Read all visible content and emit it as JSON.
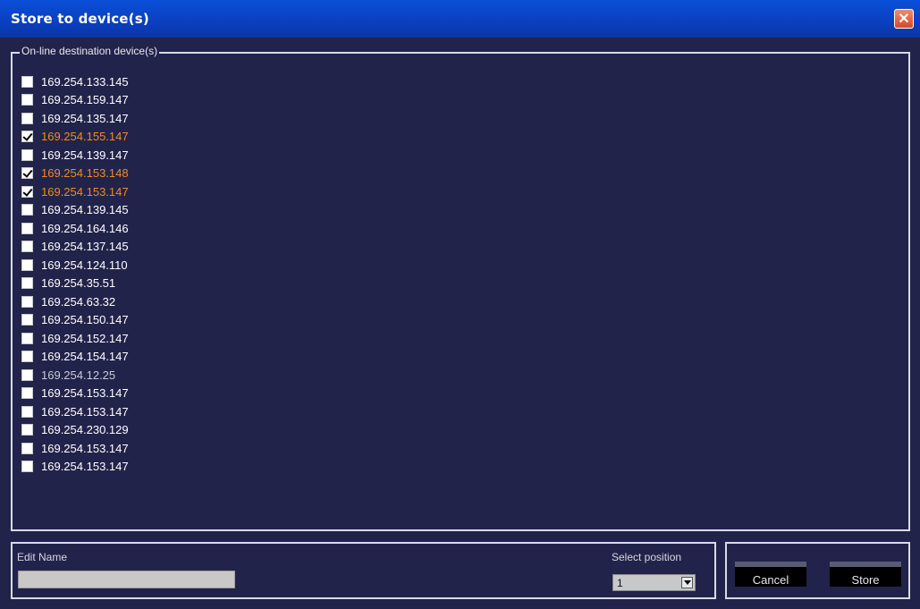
{
  "window": {
    "title": "Store to device(s)"
  },
  "devices_group": {
    "legend": "On-line destination device(s)",
    "items": [
      {
        "ip": "169.254.133.145",
        "checked": false,
        "state": "normal"
      },
      {
        "ip": "169.254.159.147",
        "checked": false,
        "state": "normal"
      },
      {
        "ip": "169.254.135.147",
        "checked": false,
        "state": "normal"
      },
      {
        "ip": "169.254.155.147",
        "checked": true,
        "state": "selected"
      },
      {
        "ip": "169.254.139.147",
        "checked": false,
        "state": "normal"
      },
      {
        "ip": "169.254.153.148",
        "checked": true,
        "state": "selected"
      },
      {
        "ip": "169.254.153.147",
        "checked": true,
        "state": "selected"
      },
      {
        "ip": "169.254.139.145",
        "checked": false,
        "state": "normal"
      },
      {
        "ip": "169.254.164.146",
        "checked": false,
        "state": "normal"
      },
      {
        "ip": "169.254.137.145",
        "checked": false,
        "state": "normal"
      },
      {
        "ip": "169.254.124.110",
        "checked": false,
        "state": "normal"
      },
      {
        "ip": "169.254.35.51",
        "checked": false,
        "state": "normal"
      },
      {
        "ip": "169.254.63.32",
        "checked": false,
        "state": "normal"
      },
      {
        "ip": "169.254.150.147",
        "checked": false,
        "state": "normal"
      },
      {
        "ip": "169.254.152.147",
        "checked": false,
        "state": "normal"
      },
      {
        "ip": "169.254.154.147",
        "checked": false,
        "state": "normal"
      },
      {
        "ip": "169.254.12.25",
        "checked": false,
        "state": "dim"
      },
      {
        "ip": "169.254.153.147",
        "checked": false,
        "state": "normal"
      },
      {
        "ip": "169.254.153.147",
        "checked": false,
        "state": "normal"
      },
      {
        "ip": "169.254.230.129",
        "checked": false,
        "state": "normal"
      },
      {
        "ip": "169.254.153.147",
        "checked": false,
        "state": "normal"
      },
      {
        "ip": "169.254.153.147",
        "checked": false,
        "state": "normal"
      }
    ]
  },
  "edit": {
    "name_label": "Edit Name",
    "name_value": "",
    "position_label": "Select position",
    "position_value": "1"
  },
  "buttons": {
    "cancel": "Cancel",
    "store": "Store"
  },
  "colors": {
    "background": "#22234a",
    "titlebar": "#0b3fbe",
    "selected_text": "#f08c1e"
  },
  "icons": {
    "close": "close-icon",
    "dropdown": "chevron-down-icon"
  }
}
